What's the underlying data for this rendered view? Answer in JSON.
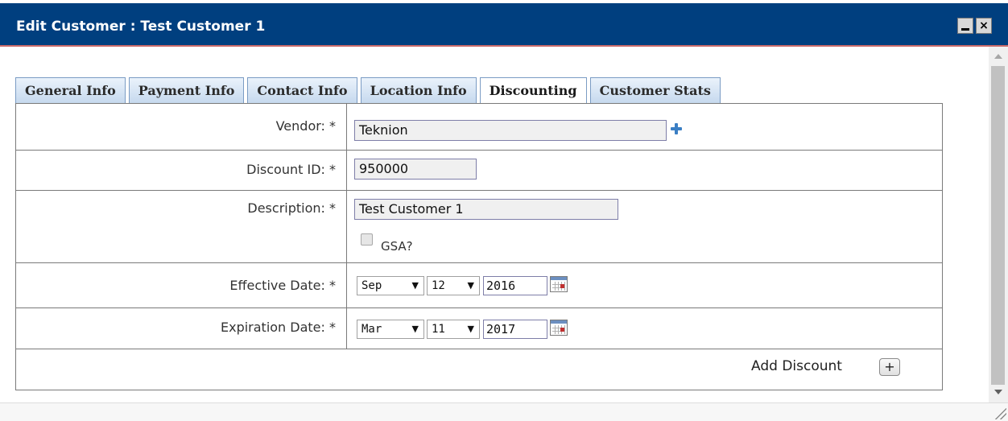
{
  "window": {
    "title": "Edit Customer : Test Customer 1",
    "minimize_glyph": "_",
    "close_glyph": "×"
  },
  "tabs": [
    {
      "label": "General Info",
      "active": false
    },
    {
      "label": "Payment Info",
      "active": false
    },
    {
      "label": "Contact Info",
      "active": false
    },
    {
      "label": "Location Info",
      "active": false
    },
    {
      "label": "Discounting",
      "active": true
    },
    {
      "label": "Customer Stats",
      "active": false
    }
  ],
  "form": {
    "vendor": {
      "label": "Vendor: *",
      "value": "Teknion"
    },
    "discount_id": {
      "label": "Discount ID: *",
      "value": "950000"
    },
    "description": {
      "label": "Description: *",
      "value": "Test Customer 1"
    },
    "gsa": {
      "label": "GSA?",
      "checked": false
    },
    "effective_date": {
      "label": "Effective Date: *",
      "month": "Sep",
      "day": "12",
      "year": "2016"
    },
    "expiration_date": {
      "label": "Expiration Date: *",
      "month": "Mar",
      "day": "11",
      "year": "2017"
    },
    "add_discount": {
      "label": "Add Discount",
      "button_glyph": "+"
    }
  },
  "dropdown_caret": "▼",
  "colors": {
    "titlebar": "#003f7f",
    "tab_gradient_top": "#eaf2fb",
    "tab_gradient_bottom": "#c6d9ee",
    "plus_icon": "#3b7fc4"
  }
}
